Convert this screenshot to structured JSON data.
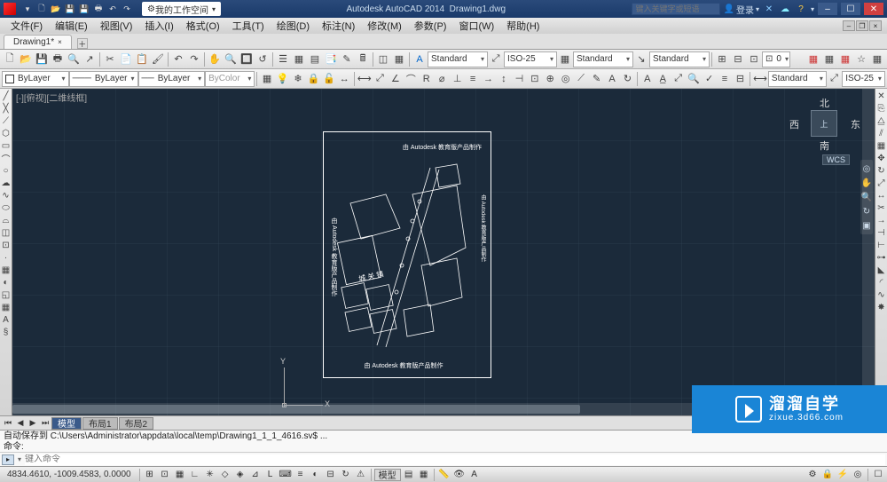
{
  "app_title": "Autodesk AutoCAD 2014",
  "doc_name": "Drawing1.dwg",
  "workspace": "我的工作空间",
  "search_placeholder": "键入关键字或短语",
  "login_text": "登录",
  "menu": [
    "文件(F)",
    "编辑(E)",
    "视图(V)",
    "插入(I)",
    "格式(O)",
    "工具(T)",
    "绘图(D)",
    "标注(N)",
    "修改(M)",
    "参数(P)",
    "窗口(W)",
    "帮助(H)"
  ],
  "file_tab": "Drawing1*",
  "props": {
    "layer": "ByLayer",
    "ltype": "ByLayer",
    "lweight": "ByLayer",
    "color": "ByColor"
  },
  "styles": {
    "text_style": "Standard",
    "dim_style": "ISO-25",
    "table_style": "Standard",
    "ml_style": "Standard"
  },
  "annot2": {
    "standard": "Standard",
    "iso": "ISO-25"
  },
  "group_combo": "0",
  "view_label": "[-][俯视][二维线框]",
  "viewcube": {
    "north": "北",
    "south": "南",
    "west": "西",
    "east": "东",
    "top": "上"
  },
  "wcs": "WCS",
  "ucs": {
    "x": "X",
    "y": "Y"
  },
  "drawing": {
    "top_right": "由 Autodesk 教育版产品制作",
    "left_vertical": "由 Autodesk 教育版产品制作",
    "right_vertical": "由 Autodesk 教育版产品制作",
    "center_label": "城 关 镇",
    "bottom": "由 Autodesk 教育版产品制作"
  },
  "model_tabs": [
    "模型",
    "布局1",
    "布局2"
  ],
  "cmd_history1": "自动保存到 C:\\Users\\Administrator\\appdata\\local\\temp\\Drawing1_1_1_4616.sv$ ...",
  "cmd_history2": "命令:",
  "cmd_placeholder": "键入命令",
  "status": {
    "coords": "4834.4610, -1009.4583, 0.0000",
    "model": "模型"
  },
  "watermark": {
    "title": "溜溜自学",
    "url": "zixue.3d66.com"
  }
}
